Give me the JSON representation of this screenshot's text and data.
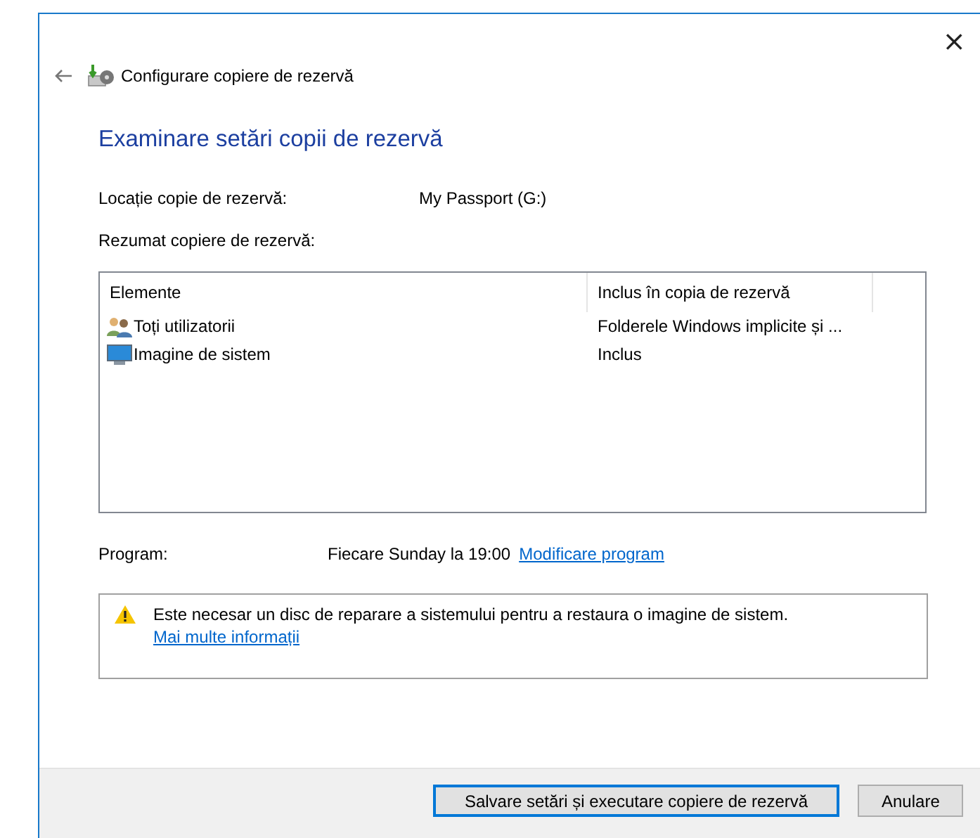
{
  "window": {
    "title": "Configurare copiere de rezervă",
    "close": "×"
  },
  "heading": "Examinare setări copii de rezervă",
  "location": {
    "label": "Locație copie de rezervă:",
    "value": "My Passport (G:)"
  },
  "summary_label": "Rezumat copiere de rezervă:",
  "table": {
    "columns": [
      "Elemente",
      "Inclus în copia de rezervă"
    ],
    "rows": [
      {
        "kind": "users",
        "name": "Toți utilizatorii",
        "value": "Folderele Windows implicite și ..."
      },
      {
        "kind": "system",
        "name": "Imagine de sistem",
        "value": "Inclus"
      }
    ]
  },
  "schedule": {
    "label": "Program:",
    "value": "Fiecare Sunday la 19:00",
    "link": "Modificare program"
  },
  "warning": {
    "text": "Este necesar un disc de reparare a sistemului pentru a restaura o imagine de sistem.",
    "link": "Mai multe informații"
  },
  "buttons": [
    {
      "label": "Salvare setări și executare copiere de rezervă",
      "default": true
    },
    {
      "label": "Anulare",
      "default": false
    }
  ]
}
